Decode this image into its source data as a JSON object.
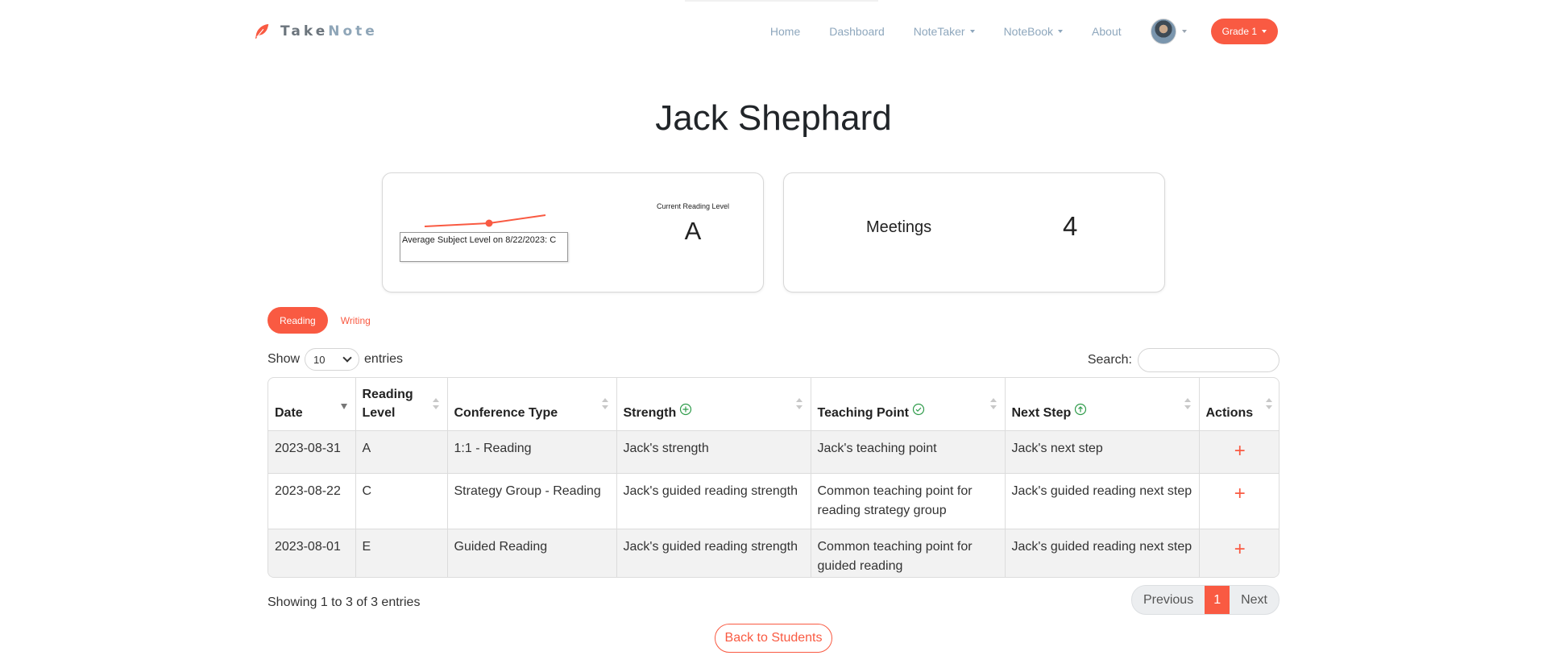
{
  "brand": {
    "part1": "Take",
    "part2": "Note",
    "icon": "feather-icon"
  },
  "nav": {
    "home": "Home",
    "dashboard": "Dashboard",
    "notetaker": "NoteTaker",
    "notebook": "NoteBook",
    "about": "About",
    "grade_label": "Grade 1"
  },
  "student": {
    "name": "Jack Shephard"
  },
  "reading_card": {
    "tooltip": "Average Subject Level on 8/22/2023: C",
    "current_level_label": "Current Reading Level",
    "current_level_value": "A",
    "sparkline_levels": [
      "E",
      "C",
      "A"
    ]
  },
  "meetings_card": {
    "label": "Meetings",
    "value": "4"
  },
  "tabs": {
    "reading": "Reading",
    "writing": "Writing"
  },
  "controls": {
    "show": "Show",
    "page_length": "10",
    "entries": "entries",
    "search_label": "Search:"
  },
  "table": {
    "headers": [
      "Date",
      "Reading Level",
      "Conference Type",
      "Strength",
      "Teaching Point",
      "Next Step",
      "Actions"
    ],
    "rows": [
      {
        "date": "2023-08-31",
        "level": "A",
        "type": "1:1 - Reading",
        "strength": "Jack's strength",
        "teaching_point": "Jack's teaching point",
        "next_step": "Jack's next step",
        "action": "+"
      },
      {
        "date": "2023-08-22",
        "level": "C",
        "type": "Strategy Group - Reading",
        "strength": "Jack's guided reading strength",
        "teaching_point": "Common teaching point for reading strategy group",
        "next_step": "Jack's guided reading next step",
        "action": "+"
      },
      {
        "date": "2023-08-01",
        "level": "E",
        "type": "Guided Reading",
        "strength": "Jack's guided reading strength",
        "teaching_point": "Common teaching point for guided reading",
        "next_step": "Jack's guided reading next step",
        "action": "+"
      }
    ]
  },
  "footer": {
    "info": "Showing 1 to 3 of 3 entries",
    "previous": "Previous",
    "page": "1",
    "next": "Next",
    "back": "Back to Students"
  },
  "colors": {
    "accent": "#f95a42",
    "nav_text": "#8ea7bd",
    "icon_green": "#2e9b4a"
  }
}
